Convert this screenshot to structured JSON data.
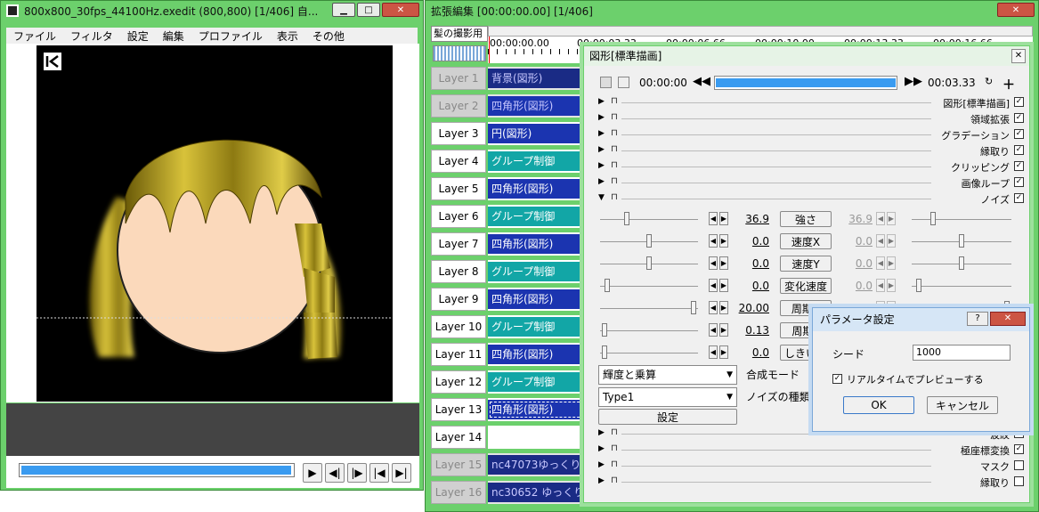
{
  "preview_window": {
    "title": "800x800_30fps_44100Hz.exedit (800,800)  [1/406]  自...",
    "menu": [
      "ファイル",
      "フィルタ",
      "設定",
      "編集",
      "プロファイル",
      "表示",
      "その他"
    ]
  },
  "timeline_window": {
    "title": "拡張編集 [00:00:00.00] [1/406]",
    "scene": "髪の撮影用",
    "ruler": [
      "00:00:00.00",
      "00:00:03.33",
      "00:00:06.66",
      "00:00:10.00",
      "00:00:13.33",
      "00:00:16.66"
    ],
    "layers": [
      {
        "name": "Layer 1",
        "clip": "背景(図形)",
        "type": "navy",
        "active": false
      },
      {
        "name": "Layer 2",
        "clip": "四角形(図形)",
        "type": "blue",
        "active": false
      },
      {
        "name": "Layer 3",
        "clip": "円(図形)",
        "type": "blue",
        "active": true
      },
      {
        "name": "Layer 4",
        "clip": "グループ制御",
        "type": "teal",
        "active": true
      },
      {
        "name": "Layer 5",
        "clip": "四角形(図形)",
        "type": "blue",
        "active": true
      },
      {
        "name": "Layer 6",
        "clip": "グループ制御",
        "type": "teal",
        "active": true
      },
      {
        "name": "Layer 7",
        "clip": "四角形(図形)",
        "type": "blue",
        "active": true
      },
      {
        "name": "Layer 8",
        "clip": "グループ制御",
        "type": "teal",
        "active": true
      },
      {
        "name": "Layer 9",
        "clip": "四角形(図形)",
        "type": "blue",
        "active": true
      },
      {
        "name": "Layer 10",
        "clip": "グループ制御",
        "type": "teal",
        "active": true
      },
      {
        "name": "Layer 11",
        "clip": "四角形(図形)",
        "type": "blue",
        "active": true
      },
      {
        "name": "Layer 12",
        "clip": "グループ制御",
        "type": "teal",
        "active": true
      },
      {
        "name": "Layer 13",
        "clip": "四角形(図形)",
        "type": "blue-selected",
        "active": true
      },
      {
        "name": "Layer 14",
        "clip": "",
        "type": "empty",
        "active": true
      },
      {
        "name": "Layer 15",
        "clip": "nc47073ゆっくり",
        "type": "navy",
        "active": false
      },
      {
        "name": "Layer 16",
        "clip": "nc30652 ゆっくり",
        "type": "navy",
        "active": false
      }
    ]
  },
  "settings_window": {
    "title": "図形[標準描画]",
    "start_time": "00:00:00",
    "end_time": "00:03.33",
    "filters_top": [
      {
        "name": "図形[標準描画]",
        "expanded": false
      },
      {
        "name": "領域拡張",
        "expanded": false
      },
      {
        "name": "グラデーション",
        "expanded": false
      },
      {
        "name": "縁取り",
        "expanded": false
      },
      {
        "name": "クリッピング",
        "expanded": false
      },
      {
        "name": "画像ループ",
        "expanded": false
      },
      {
        "name": "ノイズ",
        "expanded": true
      }
    ],
    "params": [
      {
        "label": "強さ",
        "left": "36.9",
        "right": "36.9",
        "left_pos": 0.26,
        "right_pos": 0.2
      },
      {
        "label": "速度X",
        "left": "0.0",
        "right": "0.0",
        "left_pos": 0.5,
        "right_pos": 0.5
      },
      {
        "label": "速度Y",
        "left": "0.0",
        "right": "0.0",
        "left_pos": 0.5,
        "right_pos": 0.5
      },
      {
        "label": "変化速度",
        "left": "0.0",
        "right": "0.0",
        "left_pos": 0.05,
        "right_pos": 0.05
      },
      {
        "label": "周期X",
        "left": "20.00",
        "right": "20.00",
        "left_pos": 0.98,
        "right_pos": 0.98
      },
      {
        "label": "周期Y",
        "left": "0.13",
        "right": "",
        "left_pos": 0.02,
        "right_pos": 0.02
      },
      {
        "label": "しきい値",
        "left": "0.0",
        "right": "",
        "left_pos": 0.02,
        "right_pos": 0.02
      }
    ],
    "blend_mode_value": "輝度と乗算",
    "blend_mode_label": "合成モード",
    "noise_type_value": "Type1",
    "noise_type_label": "ノイズの種類",
    "setting_button": "設定",
    "filters_bottom": [
      {
        "name": "波紋",
        "checked": true
      },
      {
        "name": "極座標変換",
        "checked": true
      },
      {
        "name": "マスク",
        "checked": false
      },
      {
        "name": "縁取り",
        "checked": false
      }
    ]
  },
  "dialog": {
    "title": "パラメータ設定",
    "seed_label": "シード",
    "seed_value": "1000",
    "realtime_label": "リアルタイムでプレビューする",
    "realtime_checked": true,
    "ok": "OK",
    "cancel": "キャンセル"
  }
}
